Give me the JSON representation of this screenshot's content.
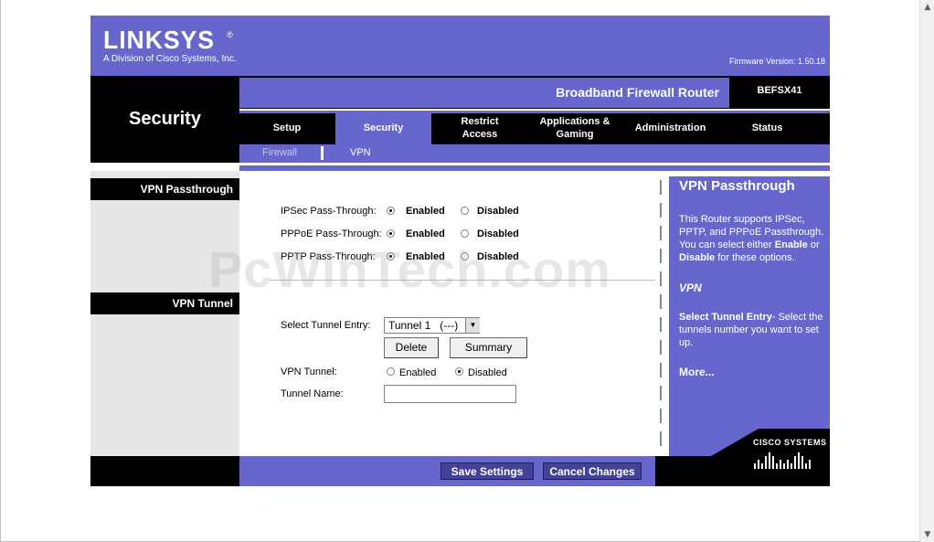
{
  "header": {
    "logo": "LINKSYS",
    "logo_mark": "®",
    "division": "A Division of Cisco Systems, Inc.",
    "firmware": "Firmware Version: 1.50.18",
    "product_name": "Broadband Firewall Router",
    "model": "BEFSX41"
  },
  "page_title": "Security",
  "tabs": [
    {
      "label": "Setup",
      "active": false
    },
    {
      "label": "Security",
      "active": true
    },
    {
      "label": "Restrict Access",
      "active": false
    },
    {
      "label": "Applications & Gaming",
      "active": false
    },
    {
      "label": "Administration",
      "active": false
    },
    {
      "label": "Status",
      "active": false
    }
  ],
  "subtabs": [
    {
      "label": "Firewall",
      "active": false
    },
    {
      "label": "VPN",
      "active": true
    }
  ],
  "sections": {
    "passthrough": "VPN Passthrough",
    "tunnel": "VPN Tunnel"
  },
  "passthrough": [
    {
      "label": "IPSec Pass-Through:",
      "enabled": "Enabled",
      "disabled": "Disabled",
      "value": "Enabled"
    },
    {
      "label": "PPPoE Pass-Through:",
      "enabled": "Enabled",
      "disabled": "Disabled",
      "value": "Enabled"
    },
    {
      "label": "PPTP Pass-Through:",
      "enabled": "Enabled",
      "disabled": "Disabled",
      "value": "Enabled"
    }
  ],
  "tunnel": {
    "select_label": "Select Tunnel Entry:",
    "select_value": "Tunnel 1   (---)",
    "delete_button": "Delete",
    "summary_button": "Summary",
    "vpn_tunnel_label": "VPN Tunnel:",
    "enabled": "Enabled",
    "disabled": "Disabled",
    "vpn_tunnel_value": "Disabled",
    "name_label": "Tunnel Name:",
    "name_value": ""
  },
  "help": {
    "title": "VPN Passthrough",
    "passthrough_text_1": "This Router supports IPSec, PPTP, and PPPoE Passthrough. You can select either ",
    "passthrough_enable": "Enable",
    "passthrough_text_2": " or ",
    "passthrough_disable": "Disable",
    "passthrough_text_3": " for these options.",
    "vpn_heading": "VPN",
    "tunnel_entry_bold": "Select Tunnel Entry",
    "tunnel_entry_text": "- Select the tunnels number you want to set up.",
    "more": "More..."
  },
  "footer": {
    "save": "Save Settings",
    "cancel": "Cancel Changes",
    "cisco": "CISCO SYSTEMS"
  },
  "watermark": "PcWinTech.com",
  "colors": {
    "brand_purple": "#6666cc",
    "black": "#000000",
    "sidebar_gray": "#e7e7e7"
  }
}
